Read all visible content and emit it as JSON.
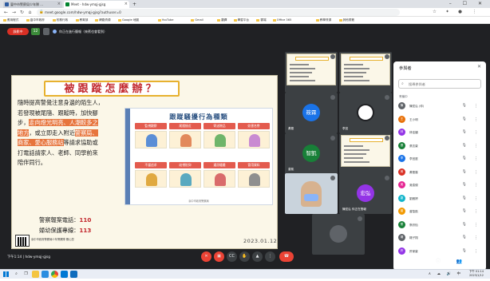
{
  "browser": {
    "tabs": [
      {
        "label": "臺中市警察局少年隊 ...",
        "active": false
      },
      {
        "label": "Meet - hdw-ymqj-gjsg",
        "active": true
      }
    ],
    "new_tab": "+",
    "window_controls": "– ☐ ✕",
    "url": "meet.google.com/hdw-ymqj-gjsg?authuser=0",
    "bookmarks": [
      "應用程式",
      "臺中市政府",
      "校務行政",
      "教育部",
      "網路資源",
      "Google 地圖",
      "YouTube",
      "Gmail",
      "翻譯",
      "學習平台",
      "雲端",
      "Office 365",
      "教學資源",
      "其他書籤"
    ]
  },
  "meet": {
    "rec_label": "錄影中",
    "info_label": "12",
    "presenter_note": "你正在進行簡報（來賓也會看到）",
    "time": "下午1:14",
    "meeting_code": "hdw-ymqj-gjsg",
    "controls": [
      "mic",
      "cam",
      "cc",
      "hand",
      "present",
      "more",
      "end"
    ],
    "right_controls": "ⓘ 👥 💬 ⚙"
  },
  "slide": {
    "title": "被跟蹤怎麼辦？",
    "body_lines": [
      {
        "text": "隨時提高警覺注意身邊的陌生人，",
        "hl": false
      },
      {
        "text": "若發現被尾隨、跟蹤時，加快腳",
        "hl": false
      },
      {
        "text": "步，",
        "hl": false,
        "tail": "走向燈光明亮、人潮較多之",
        "tail_hl": true
      },
      {
        "text": "地方",
        "hl": true,
        "tail": "，或立即走入附近",
        "tail_hl": false,
        "tail2": "警察局、",
        "tail2_hl": true
      },
      {
        "text": "商家、愛心服務站",
        "hl": true,
        "tail": "等請求協助或",
        "tail_hl": false
      },
      {
        "text": "打電話請家人、老師、同學前來",
        "hl": false
      },
      {
        "text": "陪伴同行。",
        "hl": false
      }
    ],
    "hotlines": [
      {
        "label": "警察報案電話：",
        "num": "110"
      },
      {
        "label": "婦幼保護專線：",
        "num": "113"
      }
    ],
    "date": "2023.01.12",
    "logo_text": "臺中市政府警察局少年警察隊 關心您",
    "card": {
      "title": "跟蹤騷擾行為種類",
      "labels": [
        "監視觀察",
        "尾隨接近",
        "寄送物品",
        "妨害名譽",
        "不當追求",
        "歧視貶抑",
        "通訊騷擾",
        "冒用資料"
      ],
      "footer": "臺中市政府警察局"
    }
  },
  "thumbnails": [
    {
      "kind": "slide",
      "name": "",
      "color": "#3c4043"
    },
    {
      "kind": "slide",
      "name": "",
      "color": "#3c4043"
    },
    {
      "kind": "avatar",
      "name": "黃筱",
      "initials": "筱霖",
      "color": "#1a73e8"
    },
    {
      "kind": "avatar",
      "name": "李宜",
      "initials": "",
      "color": "#ffffff"
    },
    {
      "kind": "avatar",
      "name": "曾凱",
      "initials": "智凱",
      "color": "#188038"
    },
    {
      "kind": "slide",
      "name": "",
      "color": "#3c4043"
    },
    {
      "kind": "video",
      "name": "",
      "color": "#8ab4f8"
    },
    {
      "kind": "avatar",
      "name": "陳宏弘 你正在簡報",
      "initials": "宏弘",
      "color": "#9334e6"
    },
    {
      "kind": "avatar",
      "name": "",
      "initials": "",
      "color": "#5f6368"
    }
  ],
  "panel": {
    "title": "參與者",
    "search_placeholder": "搜尋參與者",
    "section_label": "會議中",
    "people": [
      {
        "name": "陳宏弘 (你)",
        "initials": "陳",
        "color": "#5f6368"
      },
      {
        "name": "王小明",
        "initials": "王",
        "color": "#e8710a"
      },
      {
        "name": "林佳穎",
        "initials": "林",
        "color": "#9334e6"
      },
      {
        "name": "張志豪",
        "initials": "張",
        "color": "#188038"
      },
      {
        "name": "李宜庭",
        "initials": "李",
        "color": "#1a73e8"
      },
      {
        "name": "黃筱霖",
        "initials": "黃",
        "color": "#d93025"
      },
      {
        "name": "吳俊傑",
        "initials": "吳",
        "color": "#e52592"
      },
      {
        "name": "劉雅婷",
        "initials": "劉",
        "color": "#12b5cb"
      },
      {
        "name": "曾智凱",
        "initials": "曾",
        "color": "#f29900"
      },
      {
        "name": "蔡欣怡",
        "initials": "蔡",
        "color": "#188038"
      },
      {
        "name": "楊子翔",
        "initials": "楊",
        "color": "#5f6368"
      },
      {
        "name": "許家豪",
        "initials": "許",
        "color": "#9334e6"
      }
    ]
  },
  "taskbar": {
    "time": "下午 01:14",
    "date": "2023/1/12",
    "tray": "∧ ☁ 🔊 中"
  }
}
